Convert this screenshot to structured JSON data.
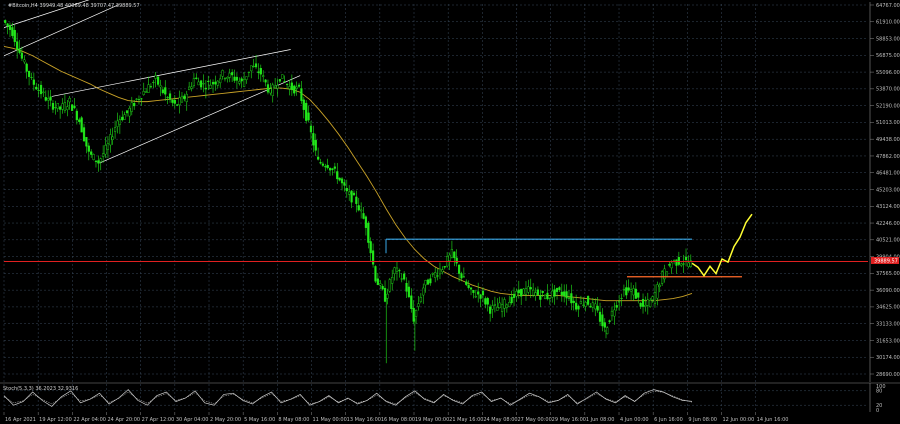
{
  "header": {
    "title": "#Bitcoin,H4  39949.48 40069.48 39707.47 39889.57"
  },
  "oscillator": {
    "label": "Stoch(5,3,3) 36.2023 32.9316",
    "levels": [
      "100",
      "80",
      "20",
      "0"
    ]
  },
  "price_tag": "39889.57",
  "colors": {
    "background": "#000000",
    "grid": "#3a4a5c",
    "bull_candle": "#22e81b",
    "bear_candle": "#22e81b",
    "moving_average": "#c9a227",
    "channel_lines": "#ffffff",
    "resistance": "#38a8e8",
    "current_price_line": "#e02020",
    "support": "#ff6a2a",
    "forecast": "#ffff33",
    "oscillator_line": "#d0d0d0"
  },
  "chart_data": {
    "type": "line",
    "title": "#Bitcoin,H4  39949.48 40069.48 39707.47 39889.57",
    "x_tick_labels": [
      "16 Apr 2021",
      "19 Apr 12:00",
      "22 Apr 04:00",
      "24 Apr 20:00",
      "27 Apr 12:00",
      "30 Apr 04:00",
      "2 May 20:00",
      "5 May 16:00",
      "8 May 08:00",
      "11 May 00:00",
      "13 May 16:00",
      "16 May 08:00",
      "19 May 00:00",
      "21 May 16:00",
      "24 May 08:00",
      "27 May 00:00",
      "29 May 16:00",
      "1 Jun 08:00",
      "4 Jun 00:00",
      "6 Jun 16:00",
      "9 Jun 08:00",
      "12 Jun 00:00",
      "14 Jun 16:00"
    ],
    "y_tick_labels": [
      "64767.00",
      "61910.00",
      "58853.00",
      "56875.00",
      "55096.00",
      "53870.00",
      "52190.00",
      "51013.00",
      "49438.00",
      "47862.00",
      "46481.00",
      "45203.00",
      "43124.00",
      "42246.00",
      "40521.00",
      "39904.00",
      "37565.00",
      "36090.00",
      "34625.00",
      "33133.00",
      "31653.00",
      "30174.00",
      "28690.00"
    ],
    "ylim": [
      28690,
      64767
    ],
    "grid": true,
    "price_series": {
      "name": "#Bitcoin",
      "values": [
        63200,
        62100,
        59500,
        57400,
        56300,
        55200,
        54700,
        55400,
        53600,
        50400,
        49600,
        51200,
        53600,
        54300,
        55600,
        56600,
        57500,
        56000,
        55000,
        55800,
        57600,
        57000,
        57200,
        58000,
        57800,
        57200,
        58800,
        58100,
        56200,
        57800,
        56800,
        56500,
        53200,
        49600,
        49400,
        48300,
        46600,
        45800,
        43600,
        38500,
        36600,
        39300,
        38300,
        34600,
        37600,
        38700,
        39500,
        40800,
        38600,
        37000,
        36900,
        35500,
        35700,
        36300,
        37100,
        37300,
        36900,
        36700,
        37200,
        36900,
        35800,
        36300,
        35600,
        33500,
        35700,
        37300,
        37200,
        35600,
        36400,
        38700,
        40000,
        40100,
        39890
      ]
    },
    "moving_average": {
      "values": [
        60700,
        60500,
        60200,
        59800,
        59300,
        58800,
        58300,
        57900,
        57500,
        57100,
        56600,
        56200,
        55800,
        55500,
        55400,
        55400,
        55500,
        55600,
        55700,
        55800,
        55900,
        56000,
        56100,
        56200,
        56300,
        56400,
        56500,
        56600,
        56700,
        56700,
        56600,
        56300,
        55600,
        54600,
        53500,
        52300,
        51000,
        49600,
        48200,
        46700,
        45100,
        43600,
        42300,
        41200,
        40300,
        39600,
        39100,
        38600,
        38200,
        37800,
        37500,
        37200,
        37000,
        36900,
        36800,
        36800,
        36800,
        36800,
        36800,
        36700,
        36600,
        36500,
        36400,
        36300,
        36300,
        36300,
        36300,
        36300,
        36300,
        36400,
        36500,
        36700,
        37000
      ]
    },
    "forecast": {
      "values": [
        39890,
        39500,
        38700,
        39600,
        38900,
        40300,
        40000,
        41500,
        42400,
        43800,
        44600
      ]
    },
    "levels": {
      "resistance": 42200,
      "current": 40060,
      "support": 38600
    },
    "channel": {
      "upper": [
        [
          0,
          62500
        ],
        [
          20,
          68500
        ]
      ],
      "lower": [
        [
          10,
          49500
        ],
        [
          31,
          57900
        ]
      ],
      "upper2": [
        [
          5,
          55900
        ],
        [
          30,
          60400
        ]
      ],
      "left_line": [
        [
          0,
          59800
        ],
        [
          12,
          64700
        ]
      ]
    },
    "stochastic": {
      "main": [
        60,
        20,
        35,
        75,
        40,
        15,
        55,
        80,
        30,
        45,
        70,
        25,
        50,
        85,
        40,
        20,
        60,
        75,
        35,
        50,
        80,
        30,
        20,
        65,
        70,
        40,
        25,
        55,
        75,
        30,
        45,
        65,
        20,
        35,
        60,
        30,
        50,
        25,
        40,
        70,
        35,
        20,
        55,
        80,
        45,
        30,
        65,
        40,
        25,
        60,
        75,
        35,
        50,
        20,
        45,
        70,
        55,
        30,
        40,
        65,
        25,
        50,
        75,
        45,
        30,
        60,
        35,
        70,
        85,
        75,
        55,
        40,
        36.2
      ],
      "signal": [
        55,
        30,
        38,
        65,
        45,
        25,
        50,
        70,
        38,
        45,
        62,
        32,
        48,
        75,
        45,
        28,
        55,
        68,
        40,
        50,
        72,
        38,
        26,
        58,
        66,
        44,
        30,
        50,
        68,
        36,
        44,
        60,
        26,
        34,
        55,
        34,
        47,
        30,
        40,
        62,
        38,
        25,
        50,
        72,
        48,
        34,
        60,
        43,
        30,
        55,
        68,
        40,
        48,
        26,
        42,
        62,
        55,
        35,
        40,
        60,
        30,
        47,
        68,
        48,
        34,
        55,
        38,
        64,
        78,
        74,
        58,
        43,
        32.9
      ]
    }
  }
}
